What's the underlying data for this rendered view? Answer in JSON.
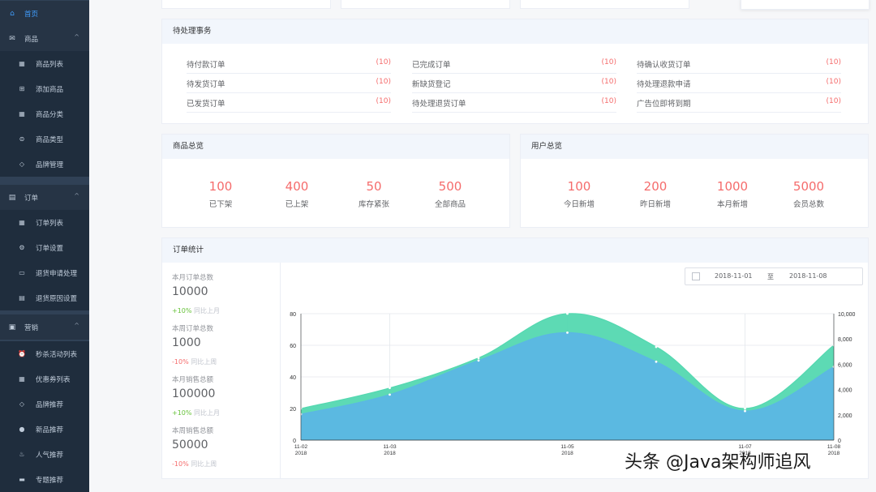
{
  "sidebar": {
    "items": [
      {
        "label": "首页",
        "icon": "home-icon",
        "glyph": "⌂",
        "kind": "top",
        "active": true
      },
      {
        "label": "商品",
        "icon": "product-icon",
        "glyph": "✉",
        "kind": "top",
        "arrow": "^"
      },
      {
        "label": "商品列表",
        "icon": "list-icon",
        "glyph": "▦",
        "kind": "sub"
      },
      {
        "label": "添加商品",
        "icon": "add-icon",
        "glyph": "⊞",
        "kind": "sub"
      },
      {
        "label": "商品分类",
        "icon": "category-icon",
        "glyph": "▦",
        "kind": "sub"
      },
      {
        "label": "商品类型",
        "icon": "type-icon",
        "glyph": "⊜",
        "kind": "sub"
      },
      {
        "label": "品牌管理",
        "icon": "tag-icon",
        "glyph": "◇",
        "kind": "sub"
      },
      {
        "label": "订单",
        "icon": "order-icon",
        "glyph": "▤",
        "kind": "top",
        "arrow": "^"
      },
      {
        "label": "订单列表",
        "icon": "list-icon",
        "glyph": "▦",
        "kind": "sub"
      },
      {
        "label": "订单设置",
        "icon": "gear-icon",
        "glyph": "⚙",
        "kind": "sub"
      },
      {
        "label": "退货申请处理",
        "icon": "return-icon",
        "glyph": "▭",
        "kind": "sub"
      },
      {
        "label": "退货原因设置",
        "icon": "reason-icon",
        "glyph": "▤",
        "kind": "sub"
      },
      {
        "label": "营销",
        "icon": "marketing-icon",
        "glyph": "▣",
        "kind": "top",
        "arrow": "^"
      },
      {
        "label": "秒杀活动列表",
        "icon": "alarm-icon",
        "glyph": "⏰",
        "kind": "sub"
      },
      {
        "label": "优惠券列表",
        "icon": "coupon-icon",
        "glyph": "▦",
        "kind": "sub"
      },
      {
        "label": "品牌推荐",
        "icon": "tag-icon",
        "glyph": "◇",
        "kind": "sub"
      },
      {
        "label": "新品推荐",
        "icon": "new-icon",
        "glyph": "●",
        "kind": "sub"
      },
      {
        "label": "人气推荐",
        "icon": "fire-icon",
        "glyph": "♨",
        "kind": "sub"
      },
      {
        "label": "专题推荐",
        "icon": "topic-icon",
        "glyph": "▬",
        "kind": "sub"
      }
    ]
  },
  "todo": {
    "title": "待处理事务",
    "rows": [
      [
        {
          "label": "待付款订单",
          "count": "(10)"
        },
        {
          "label": "已完成订单",
          "count": "(10)"
        },
        {
          "label": "待确认收货订单",
          "count": "(10)"
        }
      ],
      [
        {
          "label": "待发货订单",
          "count": "(10)"
        },
        {
          "label": "新缺货登记",
          "count": "(10)"
        },
        {
          "label": "待处理退款申请",
          "count": "(10)"
        }
      ],
      [
        {
          "label": "已发货订单",
          "count": "(10)"
        },
        {
          "label": "待处理退货订单",
          "count": "(10)"
        },
        {
          "label": "广告位即将到期",
          "count": "(10)"
        }
      ]
    ]
  },
  "product_overview": {
    "title": "商品总览",
    "stats": [
      {
        "value": "100",
        "label": "已下架"
      },
      {
        "value": "400",
        "label": "已上架"
      },
      {
        "value": "50",
        "label": "库存紧张"
      },
      {
        "value": "500",
        "label": "全部商品"
      }
    ]
  },
  "user_overview": {
    "title": "用户总览",
    "stats": [
      {
        "value": "100",
        "label": "今日新增"
      },
      {
        "value": "200",
        "label": "昨日新增"
      },
      {
        "value": "1000",
        "label": "本月新增"
      },
      {
        "value": "5000",
        "label": "会员总数"
      }
    ]
  },
  "order_stats": {
    "title": "订单统计",
    "summary": [
      {
        "label": "本月订单总数",
        "value": "10000",
        "change": "+10%",
        "direction": "up",
        "compare": "同比上月"
      },
      {
        "label": "本周订单总数",
        "value": "1000",
        "change": "-10%",
        "direction": "down",
        "compare": "同比上周"
      },
      {
        "label": "本月销售总额",
        "value": "100000",
        "change": "+10%",
        "direction": "up",
        "compare": "同比上月"
      },
      {
        "label": "本周销售总额",
        "value": "50000",
        "change": "-10%",
        "direction": "down",
        "compare": "同比上周"
      }
    ],
    "date_start": "2018-11-01",
    "date_sep": "至",
    "date_end": "2018-11-08"
  },
  "chart_data": {
    "type": "area",
    "x": [
      "11-02 2018",
      "11-03 2018",
      "11-04",
      "11-05 2018",
      "11-06",
      "11-07 2018",
      "11-08 2018"
    ],
    "x_ticks": [
      {
        "day": "11-02",
        "year": "2018",
        "i": 0
      },
      {
        "day": "11-03",
        "year": "2018",
        "i": 1
      },
      {
        "day": "11-05",
        "year": "2018",
        "i": 3
      },
      {
        "day": "11-07",
        "year": "2018",
        "i": 5
      },
      {
        "day": "11-08",
        "year": "2018",
        "i": 6
      }
    ],
    "series": [
      {
        "axis": "left",
        "color": "#54d8b0",
        "values": [
          20,
          33,
          52,
          80,
          59,
          20,
          60
        ]
      },
      {
        "axis": "right",
        "color": "#5bb7e4",
        "values": [
          2050,
          3600,
          6300,
          8500,
          6200,
          2300,
          5800
        ]
      }
    ],
    "ylim_left": [
      0,
      80
    ],
    "yticks_left": [
      "0",
      "20",
      "40",
      "60",
      "80"
    ],
    "ylim_right": [
      0,
      10000
    ],
    "yticks_right": [
      "0",
      "2,000",
      "4,000",
      "6,000",
      "8,000",
      "10,000"
    ],
    "grid": true
  },
  "watermark": "头条 @Java架构师追风"
}
